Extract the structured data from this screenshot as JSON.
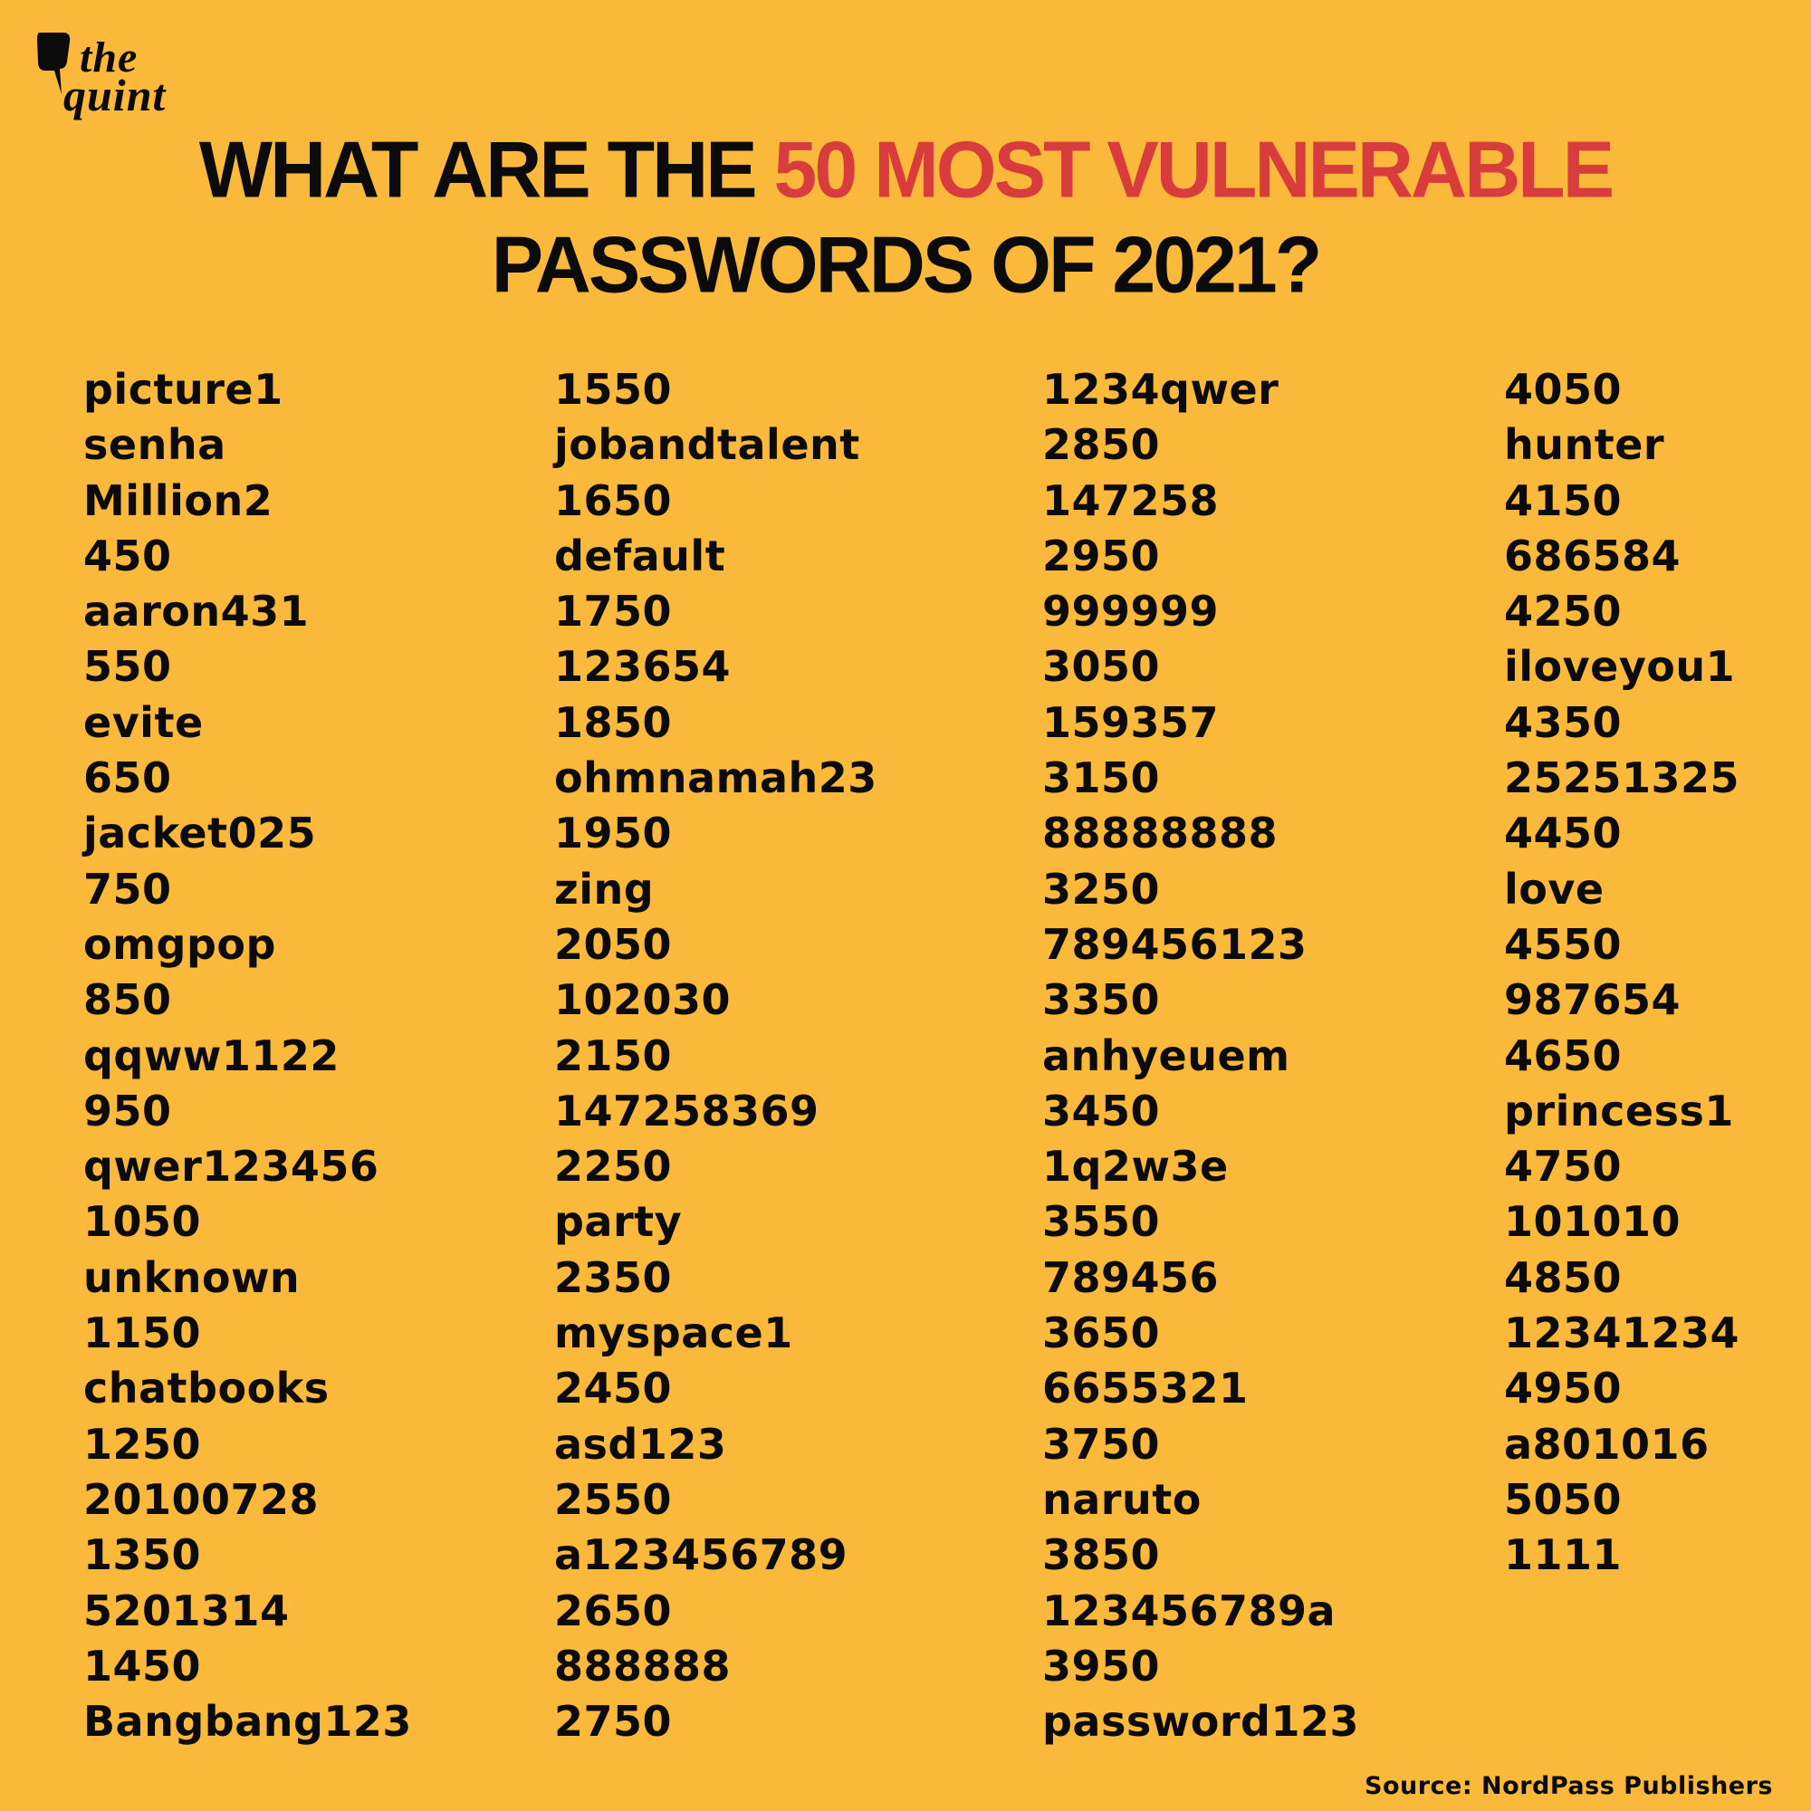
{
  "brand": {
    "logo_line1": "the",
    "logo_line2": "quint",
    "background_color": "#fbb93b",
    "accent_color": "#d93c3c",
    "text_color": "#0b0b0b"
  },
  "headline": {
    "part1": "WHAT ARE THE ",
    "highlight": "50 MOST VULNERABLE",
    "line2": "PASSWORDS OF 2021?"
  },
  "columns": [
    {
      "items": [
        "picture1",
        "senha",
        "Million2",
        "450",
        "aaron431",
        "550",
        "evite",
        "650",
        "jacket025",
        "750",
        "omgpop",
        "850",
        "qqww1122",
        "950",
        "qwer123456",
        "1050",
        "unknown",
        "1150",
        "chatbooks",
        "1250",
        "20100728",
        "1350",
        "5201314",
        "1450",
        "Bangbang123"
      ]
    },
    {
      "items": [
        "1550",
        "jobandtalent",
        "1650",
        "default",
        "1750",
        "123654",
        "1850",
        "ohmnamah23",
        "1950",
        "zing",
        "2050",
        "102030",
        "2150",
        "147258369",
        "2250",
        "party",
        "2350",
        "myspace1",
        "2450",
        "asd123",
        "2550",
        "a123456789",
        "2650",
        "888888",
        "2750"
      ]
    },
    {
      "items": [
        "1234qwer",
        "2850",
        "147258",
        "2950",
        "999999",
        "3050",
        "159357",
        "3150",
        "88888888",
        "3250",
        "789456123",
        "3350",
        "anhyeuem",
        "3450",
        "1q2w3e",
        "3550",
        "789456",
        "3650",
        "6655321",
        "3750",
        "naruto",
        "3850",
        "123456789a",
        "3950",
        "password123"
      ]
    },
    {
      "items": [
        "4050",
        "hunter",
        "4150",
        "686584",
        "4250",
        "iloveyou1",
        "4350",
        "25251325",
        "4450",
        "love",
        "4550",
        "987654",
        "4650",
        "princess1",
        "4750",
        "101010",
        "4850",
        "12341234",
        "4950",
        "a801016",
        "5050",
        "1111"
      ]
    }
  ],
  "footer": {
    "source": "Source: NordPass Publishers"
  }
}
